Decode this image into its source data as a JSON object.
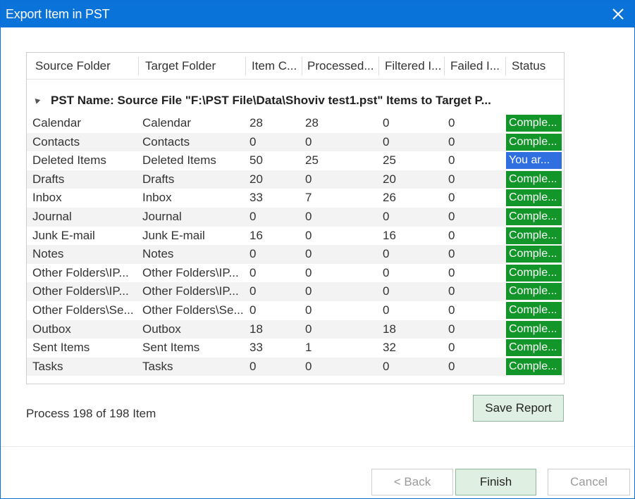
{
  "window": {
    "title": "Export Item in PST"
  },
  "columns": [
    "Source Folder",
    "Target Folder",
    "Item C...",
    "Processed...",
    "Filtered I...",
    "Failed I...",
    "Status"
  ],
  "group": {
    "label": "PST Name: Source File \"F:\\PST File\\Data\\Shoviv test1.pst\" Items to Target P..."
  },
  "rows": [
    {
      "source": "Calendar",
      "target": "Calendar",
      "items": "28",
      "processed": "28",
      "filtered": "0",
      "failed": "0",
      "status": "Comple...",
      "status_kind": "complete"
    },
    {
      "source": "Contacts",
      "target": "Contacts",
      "items": "0",
      "processed": "0",
      "filtered": "0",
      "failed": "0",
      "status": "Comple...",
      "status_kind": "complete"
    },
    {
      "source": "Deleted Items",
      "target": "Deleted Items",
      "items": "50",
      "processed": "25",
      "filtered": "25",
      "failed": "0",
      "status": "You ar...",
      "status_kind": "info"
    },
    {
      "source": "Drafts",
      "target": "Drafts",
      "items": "20",
      "processed": "0",
      "filtered": "20",
      "failed": "0",
      "status": "Comple...",
      "status_kind": "complete"
    },
    {
      "source": "Inbox",
      "target": "Inbox",
      "items": "33",
      "processed": "7",
      "filtered": "26",
      "failed": "0",
      "status": "Comple...",
      "status_kind": "complete"
    },
    {
      "source": "Journal",
      "target": "Journal",
      "items": "0",
      "processed": "0",
      "filtered": "0",
      "failed": "0",
      "status": "Comple...",
      "status_kind": "complete"
    },
    {
      "source": "Junk E-mail",
      "target": "Junk E-mail",
      "items": "16",
      "processed": "0",
      "filtered": "16",
      "failed": "0",
      "status": "Comple...",
      "status_kind": "complete"
    },
    {
      "source": "Notes",
      "target": "Notes",
      "items": "0",
      "processed": "0",
      "filtered": "0",
      "failed": "0",
      "status": "Comple...",
      "status_kind": "complete"
    },
    {
      "source": "Other Folders\\IP...",
      "target": "Other Folders\\IP...",
      "items": "0",
      "processed": "0",
      "filtered": "0",
      "failed": "0",
      "status": "Comple...",
      "status_kind": "complete"
    },
    {
      "source": "Other Folders\\IP...",
      "target": "Other Folders\\IP...",
      "items": "0",
      "processed": "0",
      "filtered": "0",
      "failed": "0",
      "status": "Comple...",
      "status_kind": "complete"
    },
    {
      "source": "Other Folders\\Se...",
      "target": "Other Folders\\Se...",
      "items": "0",
      "processed": "0",
      "filtered": "0",
      "failed": "0",
      "status": "Comple...",
      "status_kind": "complete"
    },
    {
      "source": "Outbox",
      "target": "Outbox",
      "items": "18",
      "processed": "0",
      "filtered": "18",
      "failed": "0",
      "status": "Comple...",
      "status_kind": "complete"
    },
    {
      "source": "Sent Items",
      "target": "Sent Items",
      "items": "33",
      "processed": "1",
      "filtered": "32",
      "failed": "0",
      "status": "Comple...",
      "status_kind": "complete"
    },
    {
      "source": "Tasks",
      "target": "Tasks",
      "items": "0",
      "processed": "0",
      "filtered": "0",
      "failed": "0",
      "status": "Comple...",
      "status_kind": "complete"
    }
  ],
  "footer": {
    "process_text": "Process 198 of 198 Item",
    "save_report": "Save Report",
    "back": "< Back",
    "finish": "Finish",
    "cancel": "Cancel"
  },
  "colors": {
    "title_bar": "#0a73d9",
    "status_complete": "#12962a",
    "status_info": "#2f6fe0"
  },
  "icons": {
    "close": "close-icon",
    "group_toggle": "collapse-triangle-icon"
  }
}
